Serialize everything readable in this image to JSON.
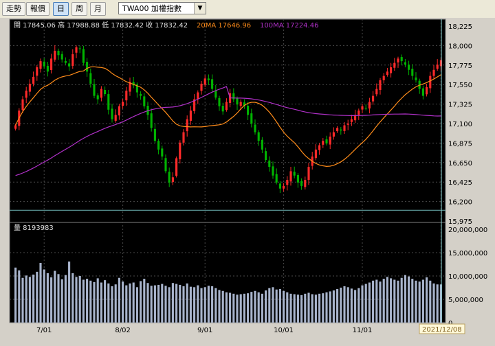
{
  "toolbar": {
    "buttons": [
      "走勢",
      "報價",
      "日",
      "周",
      "月"
    ],
    "active_index": 2,
    "symbol": "TWA00 加權指數",
    "dropdown_icon": "chevron-down-icon"
  },
  "price_panel": {
    "ohlc_label": "開 17845.06 高 17988.88 低 17832.42 收 17832.42",
    "ma20_label": "20MA 17646.96",
    "ma100_label": "100MA 17224.46",
    "ma20_color": "#ff8c1a",
    "ma100_color": "#b030c8"
  },
  "volume_panel": {
    "label": "量 8193983"
  },
  "date_tooltip": "2021/12/08",
  "colors": {
    "up": "#ff2a2a",
    "down": "#00b400",
    "volume": "#a8b4cc",
    "background": "#000000"
  },
  "chart_data": {
    "type": "candlestick",
    "price_axis": {
      "ylim": [
        15975,
        18225
      ],
      "ticks": [
        "18,225",
        "18,000",
        "17,775",
        "17,550",
        "17,325",
        "17,100",
        "16,875",
        "16,650",
        "16,425",
        "16,200",
        "15,975"
      ]
    },
    "volume_axis": {
      "ylim": [
        0,
        20000000
      ],
      "ticks": [
        "20,000,000",
        "15,000,000",
        "10,000,000",
        "5,000,000",
        "0"
      ]
    },
    "x_labels": [
      {
        "label": "7/01",
        "bar": 8
      },
      {
        "label": "8/02",
        "bar": 30
      },
      {
        "label": "9/01",
        "bar": 53
      },
      {
        "label": "10/01",
        "bar": 75
      },
      {
        "label": "11/01",
        "bar": 97
      },
      {
        "label": "1",
        "bar": 119
      }
    ],
    "closes": [
      17080,
      17250,
      17380,
      17480,
      17560,
      17640,
      17750,
      17820,
      17760,
      17700,
      17850,
      17940,
      17890,
      17840,
      17800,
      17760,
      17900,
      17980,
      17960,
      17800,
      17700,
      17560,
      17420,
      17380,
      17500,
      17440,
      17260,
      17150,
      17200,
      17300,
      17350,
      17480,
      17580,
      17540,
      17460,
      17420,
      17300,
      17200,
      17050,
      16900,
      16800,
      16720,
      16550,
      16420,
      16480,
      16700,
      16880,
      17000,
      17150,
      17250,
      17380,
      17460,
      17560,
      17620,
      17600,
      17500,
      17400,
      17300,
      17240,
      17350,
      17450,
      17380,
      17320,
      17350,
      17300,
      17200,
      17100,
      17000,
      16900,
      16800,
      16680,
      16600,
      16500,
      16420,
      16350,
      16380,
      16450,
      16550,
      16500,
      16420,
      16380,
      16450,
      16600,
      16720,
      16800,
      16850,
      16900,
      16870,
      16950,
      17000,
      17050,
      17020,
      17080,
      17100,
      17150,
      17200,
      17250,
      17300,
      17280,
      17350,
      17420,
      17500,
      17600,
      17650,
      17700,
      17750,
      17800,
      17850,
      17820,
      17780,
      17720,
      17650,
      17600,
      17500,
      17420,
      17520,
      17650,
      17720,
      17780,
      17832
    ],
    "volumes": [
      11.8,
      11.2,
      9.6,
      10.1,
      9.8,
      10.3,
      10.9,
      12.8,
      11.4,
      10.6,
      9.7,
      11.1,
      10.4,
      9.3,
      10.2,
      13.1,
      10.6,
      9.8,
      10.0,
      9.2,
      9.4,
      9.0,
      8.7,
      9.5,
      8.6,
      9.1,
      8.4,
      7.8,
      8.2,
      9.6,
      8.8,
      8.0,
      8.4,
      8.6,
      7.6,
      8.9,
      9.4,
      8.5,
      7.9,
      8.0,
      8.1,
      8.3,
      7.9,
      7.6,
      8.5,
      8.3,
      8.1,
      7.8,
      8.4,
      7.7,
      7.6,
      8.0,
      7.4,
      7.6,
      7.9,
      7.8,
      7.4,
      7.0,
      6.8,
      6.5,
      6.4,
      6.2,
      6.0,
      6.1,
      6.2,
      6.3,
      6.6,
      6.8,
      6.5,
      6.2,
      6.9,
      7.4,
      7.6,
      7.1,
      7.2,
      6.8,
      6.5,
      6.2,
      6.1,
      6.0,
      5.9,
      6.2,
      6.4,
      6.1,
      6.0,
      6.2,
      6.3,
      6.5,
      6.7,
      6.9,
      7.2,
      7.5,
      7.8,
      7.6,
      7.3,
      7.0,
      7.4,
      8.0,
      8.3,
      8.6,
      9.0,
      9.2,
      8.8,
      9.4,
      9.8,
      9.5,
      9.2,
      9.0,
      9.6,
      10.2,
      9.9,
      9.4,
      9.0,
      8.8,
      9.2,
      9.7,
      9.0,
      8.4,
      8.2,
      8.19
    ]
  }
}
